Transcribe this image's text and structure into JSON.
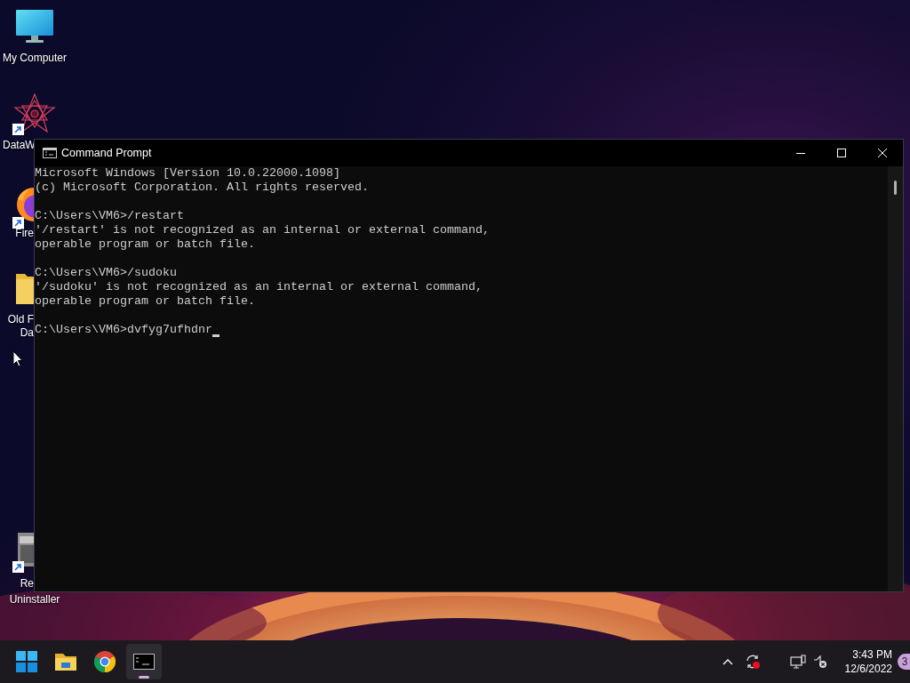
{
  "desktop_icons": [
    {
      "kind": "monitor",
      "shortcut": false,
      "label_lines": [
        "My Computer"
      ]
    },
    {
      "kind": "star",
      "shortcut": true,
      "label_lines": [
        "DataW"
      ]
    },
    {
      "kind": "firefox",
      "shortcut": true,
      "label_lines": [
        "Fire"
      ]
    },
    {
      "kind": "folder",
      "shortcut": false,
      "label_lines": [
        "Old F",
        "Da"
      ]
    },
    {
      "kind": "uninstaller",
      "shortcut": true,
      "label_lines": [
        "Re",
        "Uninstaller"
      ]
    }
  ],
  "window": {
    "title": "Command Prompt",
    "blocks": [
      [
        "Microsoft Windows [Version 10.0.22000.1098]",
        "(c) Microsoft Corporation. All rights reserved."
      ],
      [
        "C:\\Users\\VM6>/restart",
        "'/restart' is not recognized as an internal or external command,",
        "operable program or batch file."
      ],
      [
        "C:\\Users\\VM6>/sudoku",
        "'/sudoku' is not recognized as an internal or external command,",
        "operable program or batch file."
      ]
    ],
    "input_line": "C:\\Users\\VM6>dvfyg7ufhdnr"
  },
  "taskbar": {
    "apps": [
      {
        "kind": "start",
        "selected": false
      },
      {
        "kind": "explorer",
        "selected": false
      },
      {
        "kind": "chrome",
        "selected": false
      },
      {
        "kind": "terminal",
        "selected": true
      }
    ],
    "clock": {
      "time": "3:43 PM",
      "date": "12/6/2022"
    },
    "notification_count": "3"
  }
}
